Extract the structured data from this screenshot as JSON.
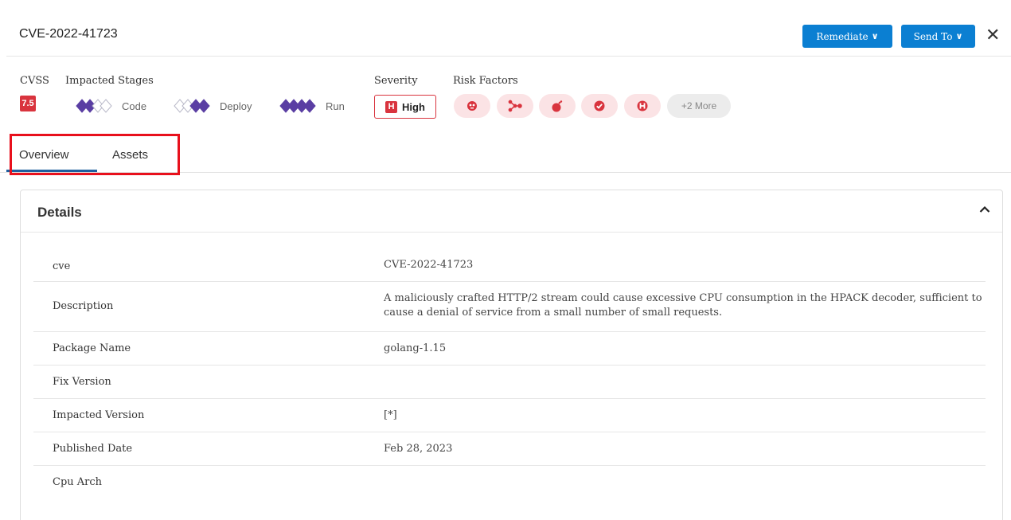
{
  "header": {
    "title": "CVE-2022-41723",
    "remediate_label": "Remediate",
    "send_to_label": "Send To",
    "close_icon": "close-icon"
  },
  "meta": {
    "cvss_label": "CVSS",
    "cvss_score": "7.5",
    "impacted_stages_label": "Impacted Stages",
    "stages": [
      {
        "name": "Code",
        "level": 2
      },
      {
        "name": "Deploy",
        "level": 2
      },
      {
        "name": "Run",
        "level": 4
      }
    ],
    "severity_label": "Severity",
    "severity_letter": "H",
    "severity_value": "High",
    "risk_factors_label": "Risk Factors",
    "risk_icons": [
      "exploit-icon",
      "attack-path-icon",
      "bomb-icon",
      "check-shield-icon",
      "high-severity-icon"
    ],
    "more_label": "+2 More"
  },
  "tabs": [
    {
      "label": "Overview",
      "active": true
    },
    {
      "label": "Assets",
      "active": false
    }
  ],
  "details": {
    "title": "Details",
    "rows": [
      {
        "key": "cve",
        "value": "CVE-2022-41723"
      },
      {
        "key": "Description",
        "value": "A maliciously crafted HTTP/2 stream could cause excessive CPU consumption in the HPACK decoder, sufficient to cause a denial of service from a small number of small requests."
      },
      {
        "key": "Package Name",
        "value": "golang-1.15"
      },
      {
        "key": "Fix Version",
        "value": ""
      },
      {
        "key": "Impacted Version",
        "value": "[*]"
      },
      {
        "key": "Published Date",
        "value": "Feb 28, 2023"
      },
      {
        "key": "Cpu Arch",
        "value": ""
      }
    ]
  },
  "colors": {
    "primary": "#0b7fd2",
    "danger": "#d9343e",
    "stage_purple": "#5a3ea3",
    "highlight_red": "#e8101c"
  }
}
